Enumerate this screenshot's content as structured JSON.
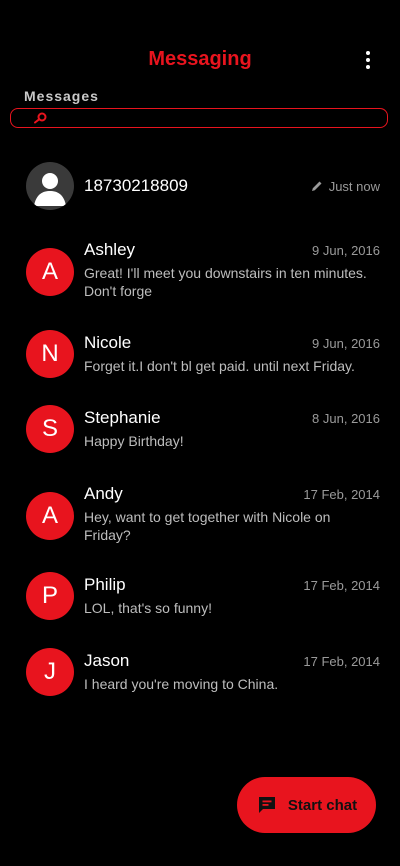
{
  "header": {
    "title": "Messaging",
    "section_label": "Messages"
  },
  "search": {
    "placeholder": ""
  },
  "conversations": [
    {
      "avatar": "",
      "name": "18730218809",
      "date": "Just now",
      "preview": ""
    },
    {
      "avatar": "A",
      "name": "Ashley",
      "date": "9 Jun, 2016",
      "preview": "Great! I'll meet you downstairs in ten minutes. Don't forge"
    },
    {
      "avatar": "N",
      "name": "Nicole",
      "date": "9 Jun, 2016",
      "preview": "Forget it.I don't bl get paid. until next Friday."
    },
    {
      "avatar": "S",
      "name": "Stephanie",
      "date": "8 Jun, 2016",
      "preview": "Happy Birthday!"
    },
    {
      "avatar": "A",
      "name": "Andy",
      "date": "17 Feb, 2014",
      "preview": "Hey, want to get together with Nicole on Friday?"
    },
    {
      "avatar": "P",
      "name": "Philip",
      "date": "17 Feb, 2014",
      "preview": "LOL, that's so funny!"
    },
    {
      "avatar": "J",
      "name": "Jason",
      "date": "17 Feb, 2014",
      "preview": "I heard you're moving to China."
    }
  ],
  "fab": {
    "label": "Start chat"
  },
  "colors": {
    "accent": "#e8141e",
    "background": "#000000"
  }
}
